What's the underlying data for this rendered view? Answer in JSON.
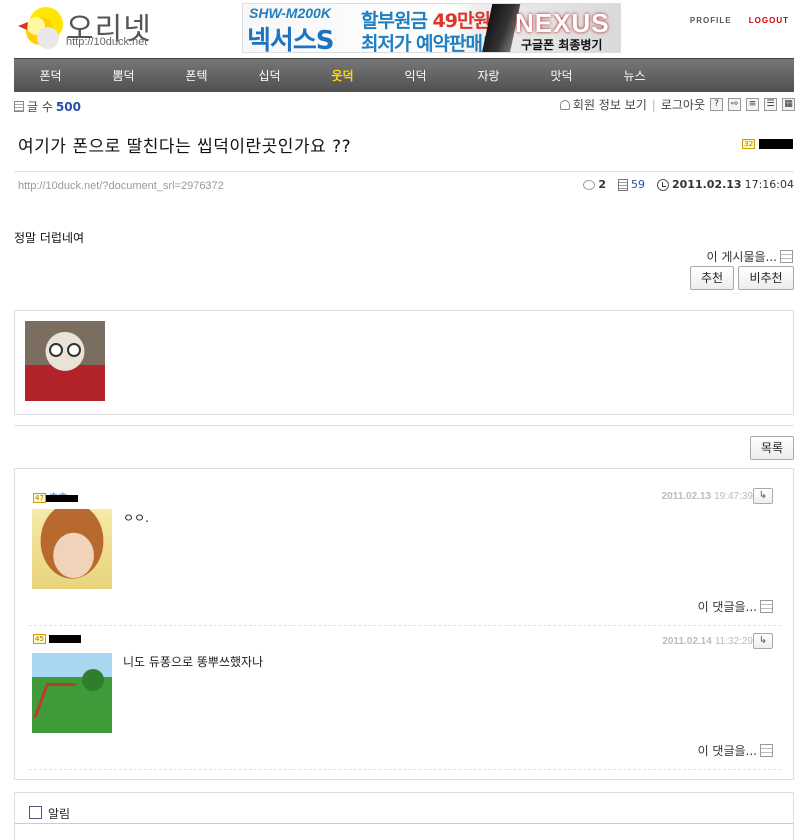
{
  "header": {
    "site_name": "오리넷",
    "site_url": "http://10duck.net",
    "banner": {
      "model": "SHW-M200K",
      "product": "넥서스S",
      "line1_a": "할부원금 ",
      "line1_price": "49만원",
      "line2": "최저가 예약판매!",
      "brand": "NEXUS",
      "tagline": "구글폰 최종병기"
    },
    "profile_label": "PROFILE",
    "logout_label": "LOGOUT"
  },
  "nav": {
    "items": [
      {
        "label": "폰덕"
      },
      {
        "label": "뽐덕"
      },
      {
        "label": "폰텍"
      },
      {
        "label": "십덕"
      },
      {
        "label": "웃덕"
      },
      {
        "label": "익덕"
      },
      {
        "label": "자랑"
      },
      {
        "label": "맛덕"
      },
      {
        "label": "뉴스"
      }
    ],
    "active_index": 4
  },
  "board": {
    "count_label": "글 수",
    "count": "500",
    "member_info": "회원 정보 보기",
    "logout": "로그아웃",
    "help_icon": "?"
  },
  "post": {
    "title": "여기가 폰으로 딸친다는 씹덕이란곳인가요 ??",
    "author_level": "32",
    "url": "http://10duck.net/?document_srl=2976372",
    "comment_count": "2",
    "read_count": "59",
    "date": "2011.02.13",
    "time": "17:16:04",
    "body": "정말 더럽네여",
    "share_label": "이 게시물을...",
    "recommend_label": "추천",
    "not_recommend_label": "비추천",
    "list_label": "목록"
  },
  "comments": [
    {
      "author_level": "47",
      "author_name": "흐흐",
      "date": "2011.02.13",
      "time": "19:47:39",
      "text": "ㅇㅇ.",
      "share_label": "이 댓글을..."
    },
    {
      "author_level": "45",
      "author_name": "",
      "date": "2011.02.14",
      "time": "11:32:29",
      "text": "니도 듀퐁으로 똥뿌쓰했자나",
      "share_label": "이 댓글을..."
    }
  ],
  "comment_form": {
    "notice_label": "알림"
  },
  "colors": {
    "nav_bg": "#5a5a5a",
    "nav_active": "#ffd800",
    "link_blue": "#2a4fa8",
    "logout_red": "#cc0000"
  }
}
